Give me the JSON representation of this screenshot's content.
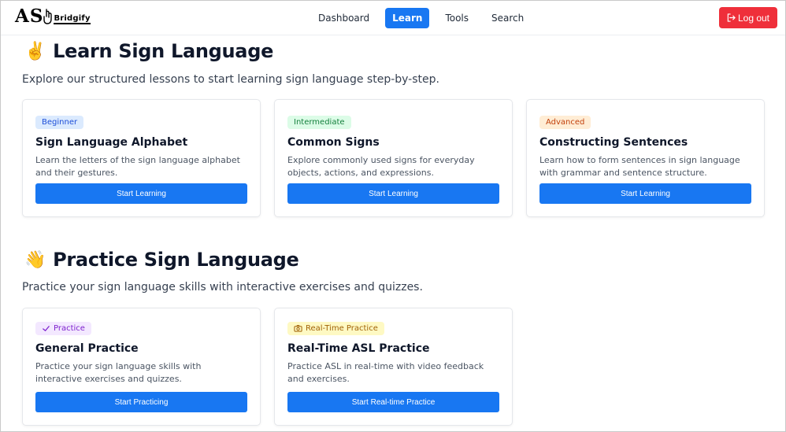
{
  "nav": {
    "logo_as": "AS",
    "logo_word": "Bridgify",
    "links": [
      "Dashboard",
      "Learn",
      "Tools",
      "Search"
    ],
    "active": "Learn",
    "logout": "Log out"
  },
  "learn": {
    "emoji": "✌️",
    "title": "Learn Sign Language",
    "subtitle": "Explore our structured lessons to start learning sign language step-by-step.",
    "cards": [
      {
        "badge": "Beginner",
        "title": "Sign Language Alphabet",
        "desc": "Learn the letters of the sign language alphabet and their gestures.",
        "button": "Start Learning"
      },
      {
        "badge": "Intermediate",
        "title": "Common Signs",
        "desc": "Explore commonly used signs for everyday objects, actions, and expressions.",
        "button": "Start Learning"
      },
      {
        "badge": "Advanced",
        "title": "Constructing Sentences",
        "desc": "Learn how to form sentences in sign language with grammar and sentence structure.",
        "button": "Start Learning"
      }
    ]
  },
  "practice": {
    "emoji": "👋",
    "title": "Practice Sign Language",
    "subtitle": "Practice your sign language skills with interactive exercises and quizzes.",
    "cards": [
      {
        "badge": "Practice",
        "title": "General Practice",
        "desc": "Practice your sign language skills with interactive exercises and quizzes.",
        "button": "Start Practicing"
      },
      {
        "badge": "Real-Time Practice",
        "title": "Real-Time ASL Practice",
        "desc": "Practice ASL in real-time with video feedback and exercises.",
        "button": "Start Real-time Practice"
      }
    ]
  },
  "colors": {
    "primary": "#1877f2",
    "logout": "#ef2f3a",
    "beginner_bg": "#dbeafe",
    "beginner_fg": "#1d4ed8",
    "intermediate_bg": "#dcfce7",
    "intermediate_fg": "#15803d",
    "advanced_bg": "#ffedd5",
    "advanced_fg": "#c2410c",
    "practice_bg": "#f3e8ff",
    "practice_fg": "#7e22ce",
    "realtime_bg": "#fef9c3",
    "realtime_fg": "#a16207"
  }
}
